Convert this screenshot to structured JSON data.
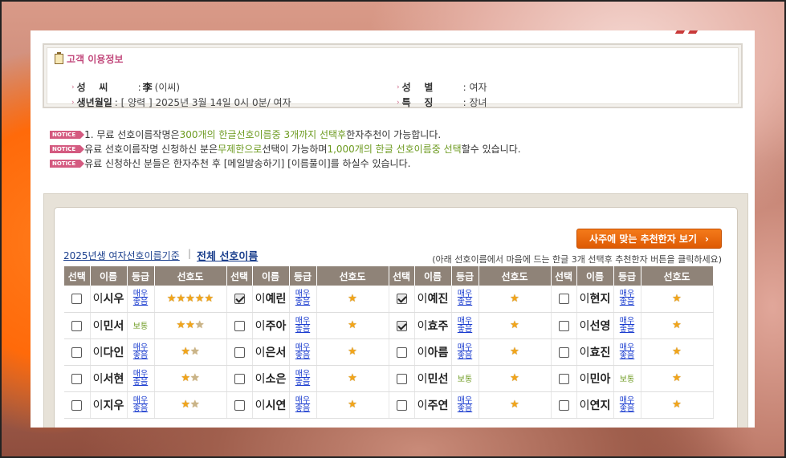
{
  "info": {
    "title": "고객 이용정보",
    "surname_label": "성    씨",
    "surname_hanja": "李",
    "surname_reading": "(이씨)",
    "birth_label": "생년월일",
    "birth_value": ": [ 양력 ] 2025년 3월 14일 0시 0분/ 여자",
    "gender_label": "성    별",
    "gender_value": ": 여자",
    "feature_label": "특    징",
    "feature_value": ": 장녀"
  },
  "notices": {
    "badge": "NOTICE",
    "n1_a": "1. 무료 선호이름작명은 ",
    "n1_b": "300개의 한글선호이름중 3개까지 선택후",
    "n1_c": " 한자추천이 가능합니다.",
    "n2_a": "유료 선호이름작명 신청하신 분은",
    "n2_b": "무제한으로",
    "n2_c": " 선택이 가능하며 ",
    "n2_d": "1,000개의 한글 선호이름중 선택",
    "n2_e": "할수 있습니다.",
    "n3": "유료 신청하신 분들은 한자추천 후 [메일발송하기] [이름풀이]를 하실수 있습니다."
  },
  "toolbar": {
    "recommend_button": "사주에 맞는 추천한자 보기",
    "year_link": "2025년생 여자선호이름기준",
    "separator": "|",
    "all_link": "전체 선호이름",
    "hint": "(아래 선호이름에서 마음에 드는 한글 3개 선택후 추천한자 버튼을 클릭하세요)"
  },
  "headers": [
    "선택",
    "이름",
    "등급",
    "선호도"
  ],
  "grades": {
    "top": "매우\n좋음",
    "mid": "보통"
  },
  "rows": [
    [
      {
        "n": "이시우",
        "g": "top",
        "s": 5,
        "c": false
      },
      {
        "n": "이예린",
        "g": "top",
        "s": 1,
        "c": true
      },
      {
        "n": "이예진",
        "g": "top",
        "s": 1,
        "c": true
      },
      {
        "n": "이현지",
        "g": "top",
        "s": 1,
        "c": false
      }
    ],
    [
      {
        "n": "이민서",
        "g": "mid",
        "s": 3,
        "c": false
      },
      {
        "n": "이주아",
        "g": "top",
        "s": 1,
        "c": false
      },
      {
        "n": "이효주",
        "g": "top",
        "s": 1,
        "c": true
      },
      {
        "n": "이선영",
        "g": "top",
        "s": 1,
        "c": false
      }
    ],
    [
      {
        "n": "이다인",
        "g": "top",
        "s": 2,
        "c": false
      },
      {
        "n": "이은서",
        "g": "top",
        "s": 1,
        "c": false
      },
      {
        "n": "이아름",
        "g": "top",
        "s": 1,
        "c": false
      },
      {
        "n": "이효진",
        "g": "top",
        "s": 1,
        "c": false
      }
    ],
    [
      {
        "n": "이서현",
        "g": "top",
        "s": 2,
        "c": false
      },
      {
        "n": "이소은",
        "g": "top",
        "s": 1,
        "c": false
      },
      {
        "n": "이민선",
        "g": "mid",
        "s": 1,
        "c": false
      },
      {
        "n": "이민아",
        "g": "mid",
        "s": 1,
        "c": false
      }
    ],
    [
      {
        "n": "이지우",
        "g": "top",
        "s": 2,
        "c": false
      },
      {
        "n": "이시연",
        "g": "top",
        "s": 1,
        "c": false
      },
      {
        "n": "이주연",
        "g": "top",
        "s": 1,
        "c": false
      },
      {
        "n": "이연지",
        "g": "top",
        "s": 1,
        "c": false
      }
    ]
  ],
  "colors": {
    "accent": "#f47a1a",
    "header_bg": "#8f8378",
    "notice": "#d45a80"
  }
}
